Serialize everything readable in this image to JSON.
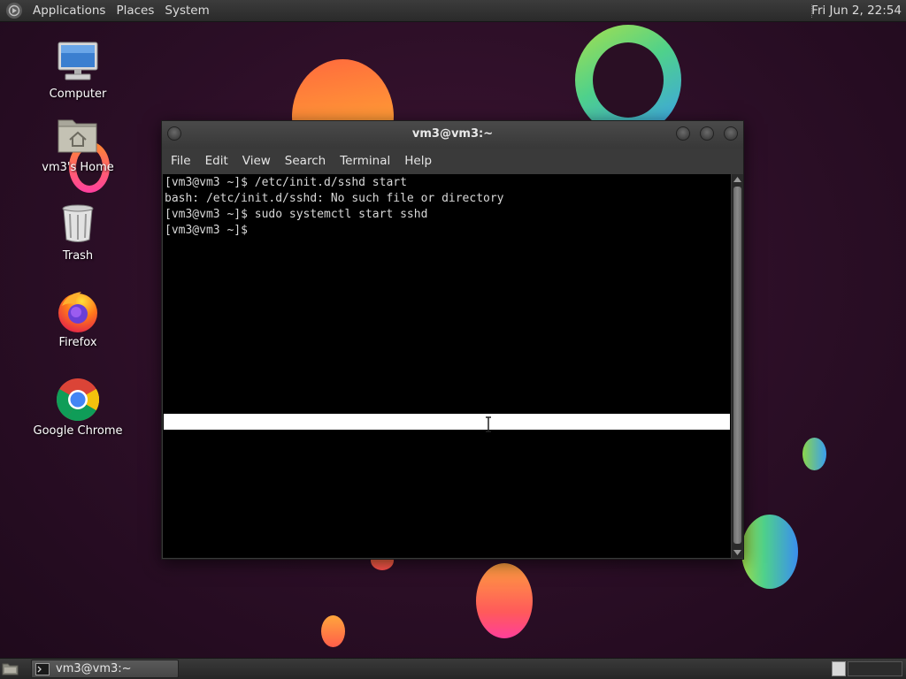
{
  "top_panel": {
    "menus": [
      "Applications",
      "Places",
      "System"
    ],
    "clock": "Fri Jun  2, 22:54"
  },
  "desktop": {
    "icons": [
      {
        "label": "Computer",
        "icon": "computer-icon"
      },
      {
        "label": "vm3's Home",
        "icon": "home-folder-icon"
      },
      {
        "label": "Trash",
        "icon": "trash-icon"
      },
      {
        "label": "Firefox",
        "icon": "firefox-icon"
      },
      {
        "label": "Google Chrome",
        "icon": "chrome-icon"
      }
    ]
  },
  "terminal": {
    "title": "vm3@vm3:~",
    "menus": [
      "File",
      "Edit",
      "View",
      "Search",
      "Terminal",
      "Help"
    ],
    "lines": [
      "[vm3@vm3 ~]$ /etc/init.d/sshd start",
      "bash: /etc/init.d/sshd: No such file or directory",
      "[vm3@vm3 ~]$ sudo systemctl start sshd",
      "[vm3@vm3 ~]$ "
    ]
  },
  "bottom_panel": {
    "taskbar_label": "vm3@vm3:~"
  },
  "colors": {
    "wallpaper_base": "#2b0e26",
    "terminal_bg": "#000000",
    "terminal_fg": "#d8d8d8",
    "panel_bg": "#333333"
  }
}
